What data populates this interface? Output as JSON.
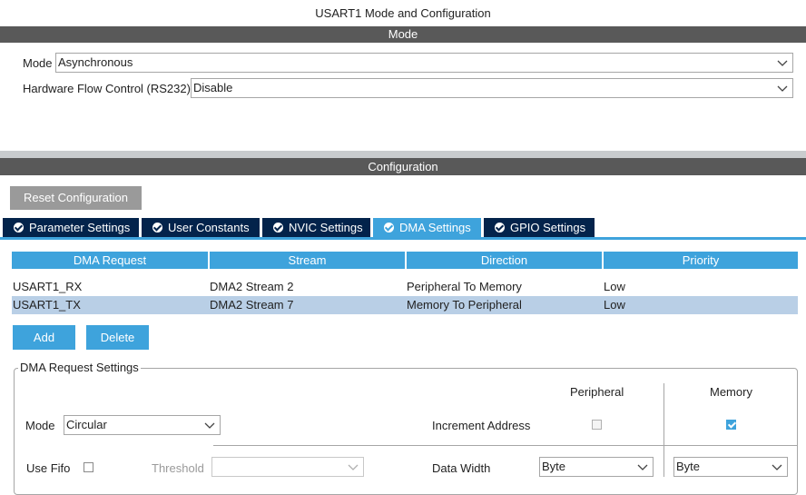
{
  "window_title": "USART1 Mode and Configuration",
  "mode_section": {
    "header": "Mode",
    "mode_label": "Mode",
    "mode_value": "Asynchronous",
    "flow_label": "Hardware Flow Control (RS232)",
    "flow_value": "Disable"
  },
  "config_section": {
    "header": "Configuration",
    "reset_button": "Reset Configuration"
  },
  "tabs": [
    {
      "label": "Parameter Settings",
      "active": false
    },
    {
      "label": "User Constants",
      "active": false
    },
    {
      "label": "NVIC Settings",
      "active": false
    },
    {
      "label": "DMA Settings",
      "active": true
    },
    {
      "label": "GPIO Settings",
      "active": false
    }
  ],
  "dma_table": {
    "columns": [
      "DMA Request",
      "Stream",
      "Direction",
      "Priority"
    ],
    "rows": [
      {
        "request": "USART1_RX",
        "stream": "DMA2 Stream 2",
        "direction": "Peripheral To Memory",
        "priority": "Low",
        "selected": false
      },
      {
        "request": "USART1_TX",
        "stream": "DMA2 Stream 7",
        "direction": "Memory To Peripheral",
        "priority": "Low",
        "selected": true
      }
    ]
  },
  "buttons": {
    "add": "Add",
    "delete": "Delete"
  },
  "request_settings": {
    "legend": "DMA Request Settings",
    "peripheral_header": "Peripheral",
    "memory_header": "Memory",
    "mode_label": "Mode",
    "mode_value": "Circular",
    "increment_label": "Increment Address",
    "peripheral_increment": false,
    "memory_increment": true,
    "use_fifo_label": "Use Fifo",
    "use_fifo": false,
    "threshold_label": "Threshold",
    "threshold_value": "",
    "data_width_label": "Data Width",
    "peripheral_width": "Byte",
    "memory_width": "Byte"
  },
  "colors": {
    "accent": "#3ea3dc",
    "tab_dark": "#03234b",
    "header_bar": "#595959",
    "selected_row": "#b9cfe6"
  }
}
